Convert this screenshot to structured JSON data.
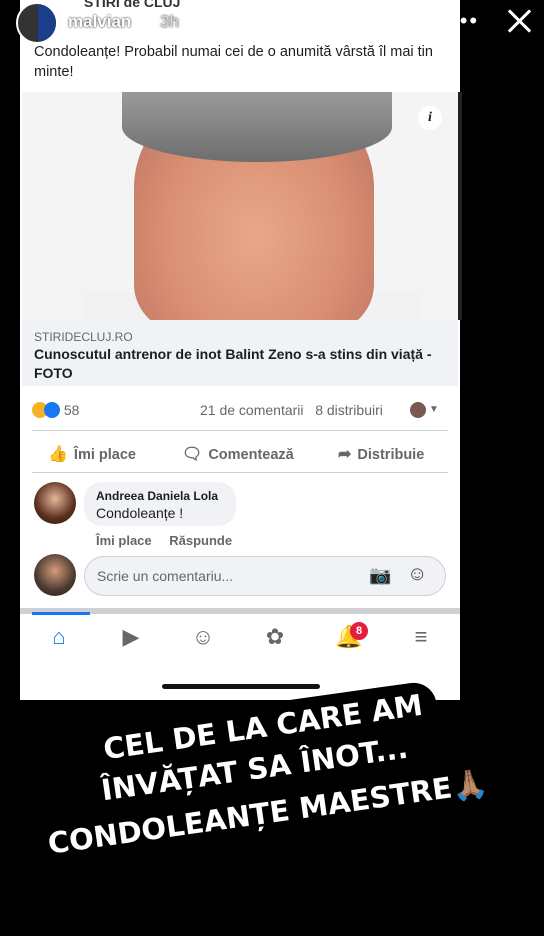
{
  "story": {
    "page_name": "STIRI de CLUJ",
    "user": "malvian",
    "time": "3h"
  },
  "post": {
    "text": "Condoleanțe! Probabil numai cei de o anumită vârstă îl mai tin minte!",
    "link": {
      "domain": "STIRIDECLUJ.RO",
      "title": "Cunoscutul antrenor de inot Balint Zeno s-a stins din viață - FOTO"
    },
    "reaction_count": "58",
    "comments_count": "21 de comentarii",
    "shares_count": "8 distribuiri"
  },
  "actions": {
    "like": "Îmi place",
    "comment": "Comentează",
    "share": "Distribuie"
  },
  "comment": {
    "author": "Andreea Daniela Lola",
    "text": "Condoleanțe !",
    "like_link": "Îmi place",
    "reply_link": "Răspunde"
  },
  "comment_input": {
    "placeholder": "Scrie un comentariu..."
  },
  "nav": {
    "notifications_badge": "8"
  },
  "sticker": {
    "line1": "CEL DE LA CARE AM",
    "line2": "ÎNVĂȚAT SA ÎNOT...",
    "line3": "CONDOLEANȚE MAESTRE🙏🏽"
  },
  "colors": {
    "facebook_blue": "#1877f2",
    "badge_red": "#e41e3f"
  }
}
